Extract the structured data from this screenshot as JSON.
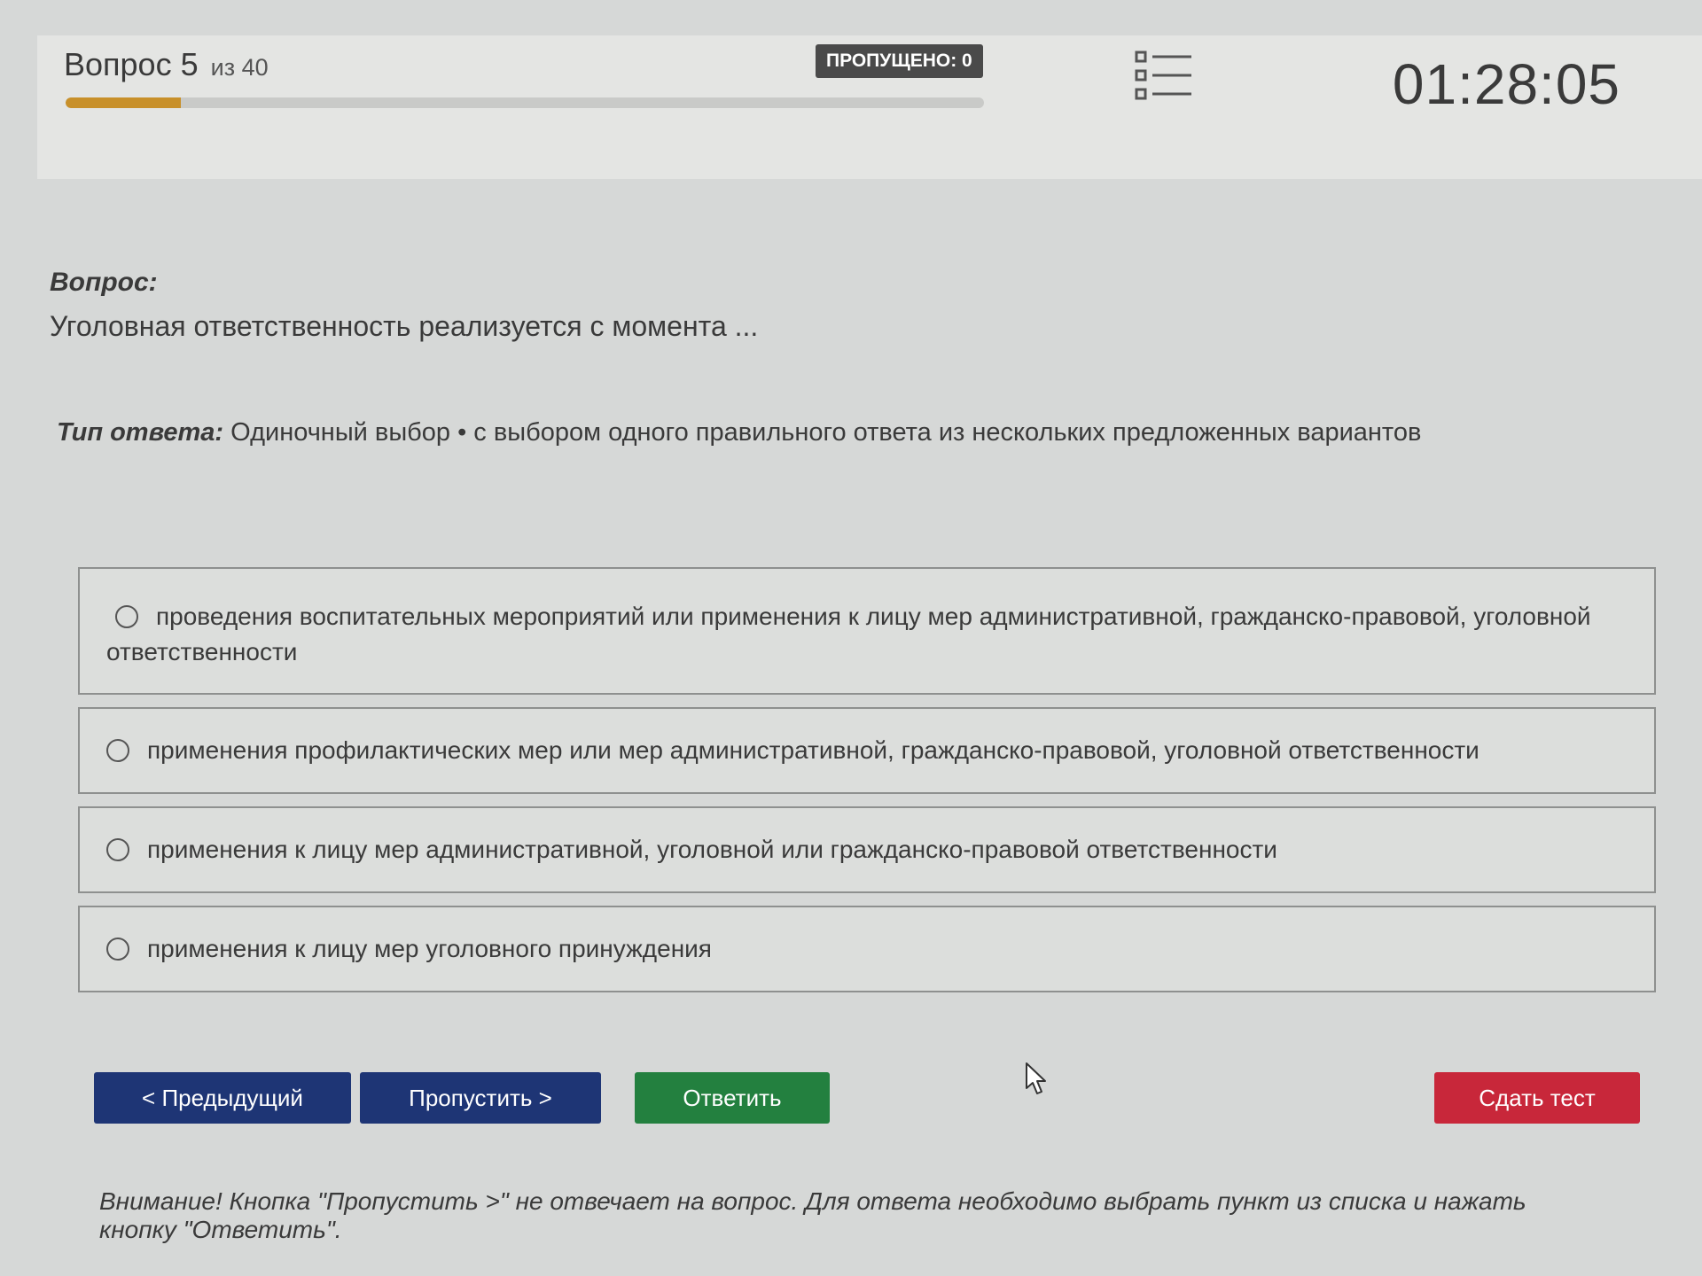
{
  "header": {
    "question_label": "Вопрос 5",
    "question_of": "из 40",
    "progress_fraction": 0.125,
    "skipped_badge": "ПРОПУЩЕНО: 0",
    "list_icon": "question-list-icon",
    "timer": "01:28:05",
    "progress_color": "#c8902a"
  },
  "question": {
    "label": "Вопрос:",
    "text": "Уголовная ответственность реализуется с момента ..."
  },
  "answer_type": {
    "label": "Тип ответа:",
    "value": "Одиночный выбор • с выбором одного правильного ответа из нескольких предложенных вариантов"
  },
  "options": [
    "проведения воспитательных мероприятий или применения к лицу мер административной, гражданско-правовой, уголовной ответственности",
    "применения профилактических мер или мер административной, гражданско-правовой, уголовной ответственности",
    "применения к лицу мер административной, уголовной или гражданско-правовой ответственности",
    "применения к лицу мер уголовного принуждения"
  ],
  "buttons": {
    "prev": "< Предыдущий",
    "skip": "Пропустить >",
    "answer": "Ответить",
    "submit": "Сдать тест"
  },
  "colors": {
    "nav_button": "#1e3575",
    "answer_button": "#23803f",
    "submit_button": "#c8273a"
  },
  "warning": "Внимание! Кнопка \"Пропустить >\" не отвечает на вопрос. Для ответа необходимо выбрать пункт из списка и нажать кнопку \"Ответить\"."
}
